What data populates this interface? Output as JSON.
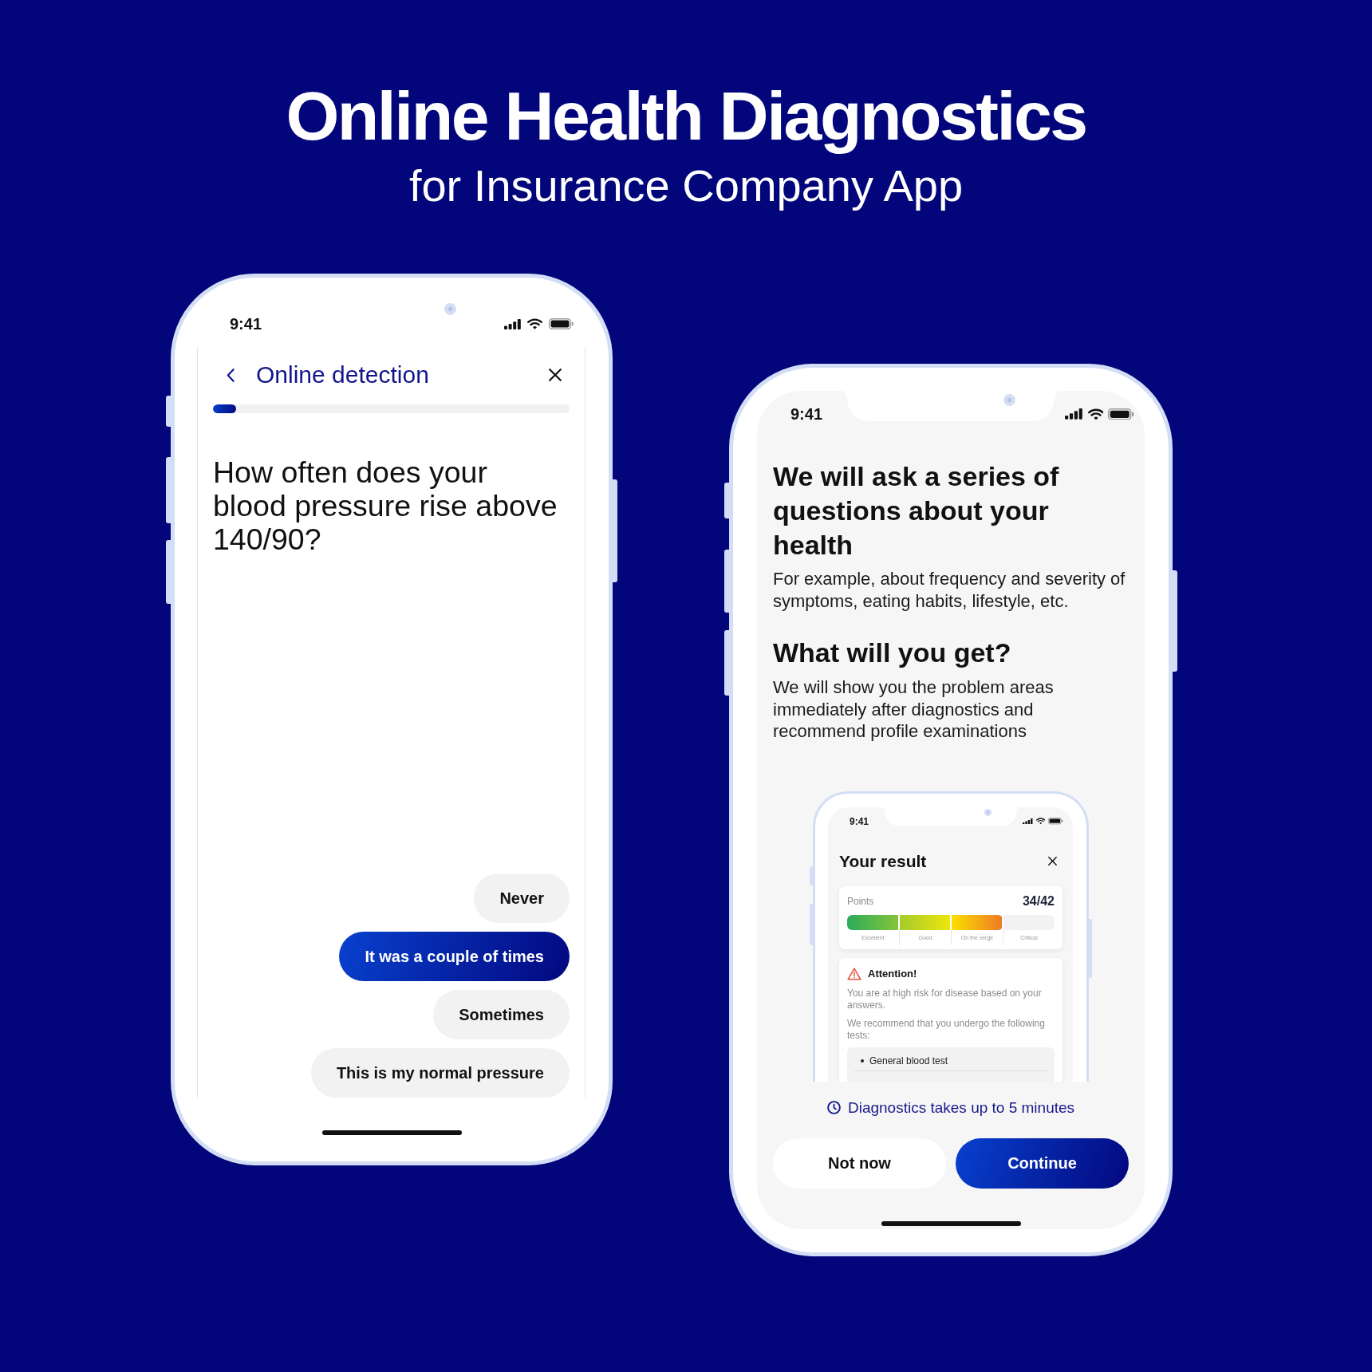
{
  "header": {
    "title": "Online Health Diagnostics",
    "subtitle": "for Insurance Company App"
  },
  "question_screen": {
    "status_bar": {
      "time": "9:41"
    },
    "title": "Online detection",
    "progress": {
      "level": 0.065
    },
    "question": "How often does your blood pressure rise above 140/90?",
    "answers": [
      {
        "label": "Never",
        "selected": false
      },
      {
        "label": "It was a couple of times",
        "selected": true
      },
      {
        "label": "Sometimes",
        "selected": false
      },
      {
        "label": "This is my normal pressure",
        "selected": false
      }
    ]
  },
  "intro_screen": {
    "status_bar": {
      "time": "9:41"
    },
    "sections": [
      {
        "title": "We will ask a series of questions about your health",
        "text": "For example, about frequency and severity of symptoms, eating habits, lifestyle, etc."
      },
      {
        "title": "What will you get?",
        "text": "We will show you the problem areas immediately after diagnostics and recommend profile examinations"
      }
    ],
    "preview": {
      "status_bar": {
        "time": "9:41"
      },
      "title": "Your result",
      "score": {
        "label": "Points",
        "value": "34/42",
        "level": 0.75,
        "scale": [
          "Excellent",
          "Good",
          "On the verge",
          "Critical"
        ]
      },
      "alert": {
        "title": "Attention!",
        "paragraphs": [
          "You are at high risk for disease based on your answers.",
          "We recommend that you undergo the following tests:"
        ],
        "tests": [
          "General blood test"
        ]
      }
    },
    "duration_note": "Diagnostics takes up to 5 minutes",
    "buttons": [
      {
        "label": "Not now",
        "kind": "secondary"
      },
      {
        "label": "Continue",
        "kind": "primary"
      }
    ]
  }
}
